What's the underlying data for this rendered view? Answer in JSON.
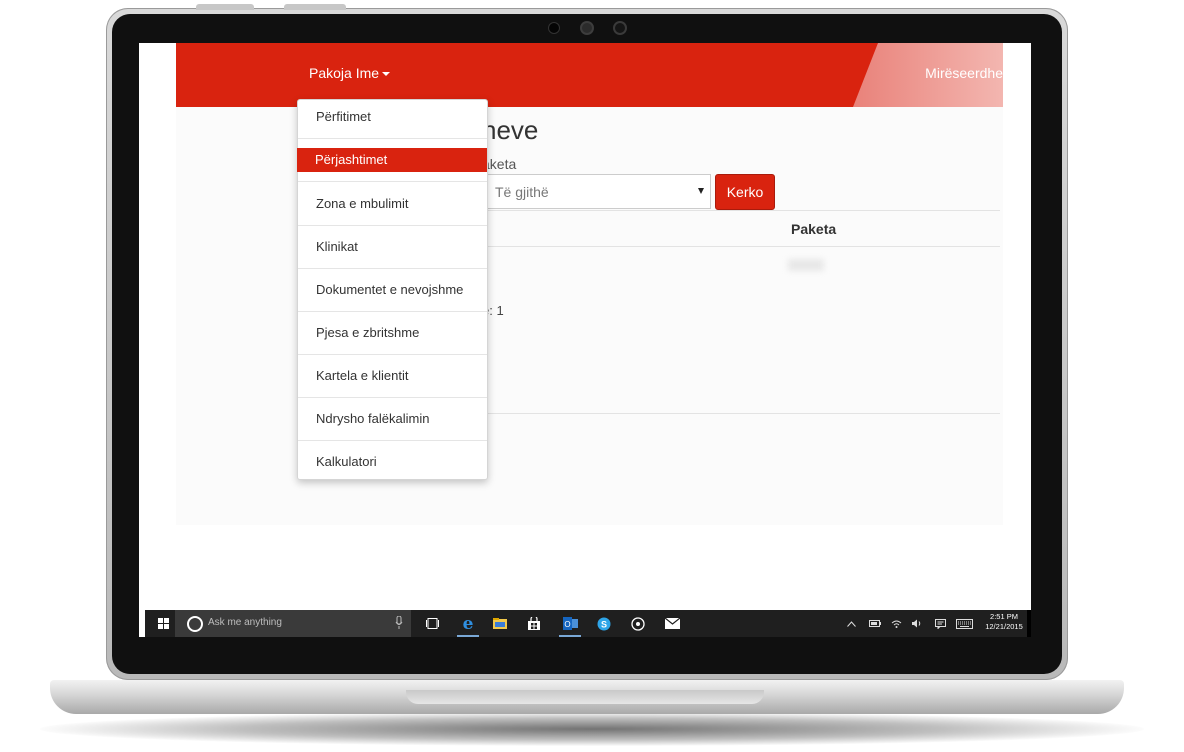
{
  "navbar": {
    "brand_label": "Pakoja Ime",
    "welcome_text": "Mirëseerdhe"
  },
  "dropdown": {
    "items": [
      {
        "label": "Përfitimet"
      },
      {
        "label": "Përjashtimet"
      },
      {
        "label": "Zona e mbulimit"
      },
      {
        "label": "Klinikat"
      },
      {
        "label": "Dokumentet e nevojshme"
      },
      {
        "label": "Pjesa e zbritshme"
      },
      {
        "label": "Kartela e klientit"
      },
      {
        "label": "Ndrysho falëkalimin"
      },
      {
        "label": "Kalkulatori"
      }
    ],
    "active_index": 1
  },
  "page": {
    "title_visible": "neve",
    "filter_label_visible": "aketa",
    "select_value": "Të gjithë",
    "search_button": "Kerko",
    "table_header_paketa": "Paketa",
    "count_text_visible": "e: 1"
  },
  "taskbar": {
    "search_placeholder": "Ask me anything",
    "clock_time": "2:51 PM",
    "clock_date": "12/21/2015"
  },
  "colors": {
    "accent": "#d9230f",
    "taskbar": "#1f1f1f"
  },
  "icons": [
    "windows-logo-icon",
    "cortana-icon",
    "microphone-icon",
    "task-view-icon",
    "edge-icon",
    "file-explorer-icon",
    "store-icon",
    "outlook-icon",
    "skype-icon",
    "groove-icon",
    "mail-icon",
    "chevron-up-icon",
    "battery-icon",
    "wifi-icon",
    "volume-icon",
    "action-center-icon",
    "keyboard-icon"
  ]
}
